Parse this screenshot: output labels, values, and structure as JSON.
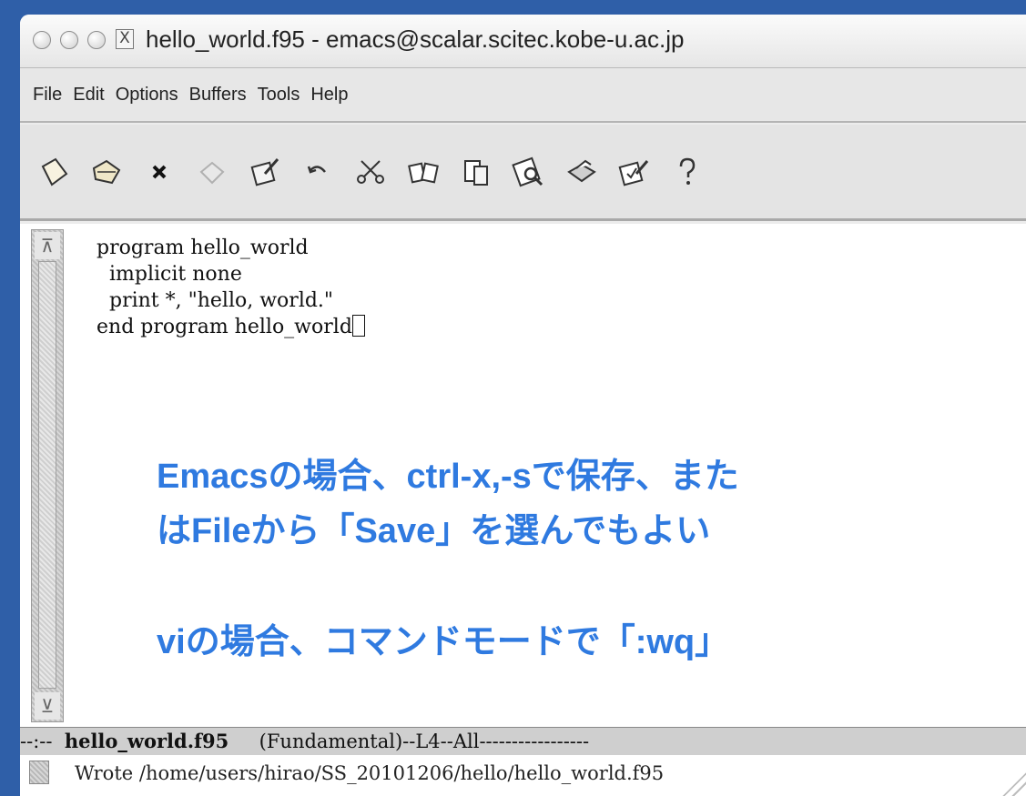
{
  "window": {
    "title": "hello_world.f95 - emacs@scalar.scitec.kobe-u.ac.jp",
    "x_glyph": "X"
  },
  "menu": {
    "items": [
      "File",
      "Edit",
      "Options",
      "Buffers",
      "Tools",
      "Help"
    ]
  },
  "toolbar": {
    "icons": [
      "new-file-icon",
      "open-folder-icon",
      "close-icon",
      "save-disk-icon",
      "edit-pencil-icon",
      "undo-icon",
      "cut-scissors-icon",
      "copy-icon",
      "paste-icon",
      "search-icon",
      "print-icon",
      "customize-icon",
      "help-icon"
    ]
  },
  "editor": {
    "code_lines": [
      "program hello_world",
      "  implicit none",
      "  print *, \"hello, world.\"",
      "end program hello_world"
    ]
  },
  "annotations": {
    "line1": "Emacsの場合、ctrl-x,-sで保存、また",
    "line2": "はFileから「Save」を選んでもよい",
    "line3": "viの場合、コマンドモードで「:wq」",
    "color": "#2f7ae0"
  },
  "modeline": {
    "prefix": "--:--  ",
    "buffer": "hello_world.f95",
    "rest": "     (Fundamental)--L4--All-----------------"
  },
  "minibuffer": {
    "message": "Wrote /home/users/hirao/SS_20101206/hello/hello_world.f95"
  }
}
